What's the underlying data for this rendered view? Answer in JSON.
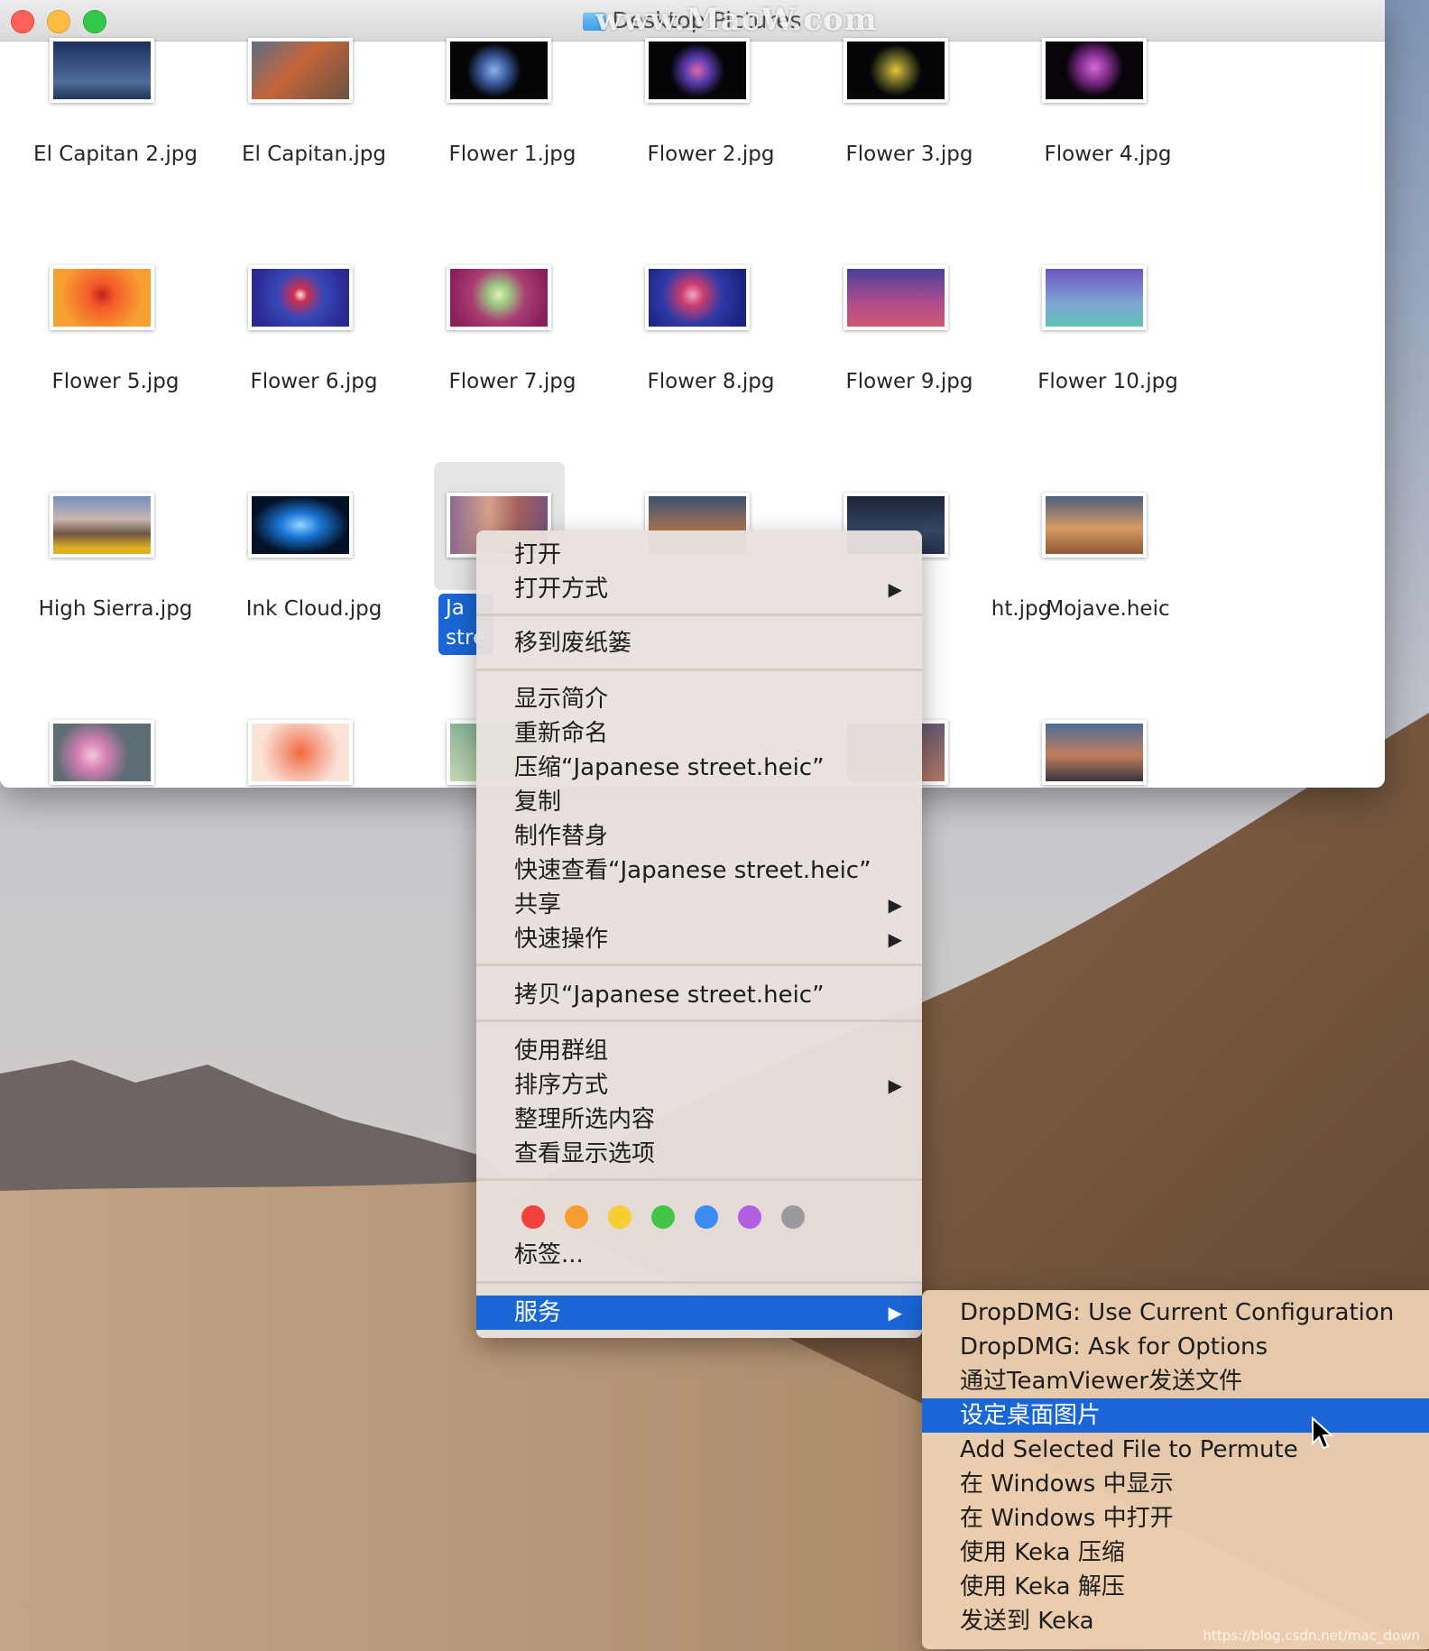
{
  "window": {
    "title": "Desktop Pictures",
    "watermark": "www.MacW.com"
  },
  "files": [
    {
      "name": "El Capitan 2.jpg"
    },
    {
      "name": "El Capitan.jpg"
    },
    {
      "name": "Flower 1.jpg"
    },
    {
      "name": "Flower 2.jpg"
    },
    {
      "name": "Flower 3.jpg"
    },
    {
      "name": "Flower 4.jpg"
    },
    {
      "name": "Flower 5.jpg"
    },
    {
      "name": "Flower 6.jpg"
    },
    {
      "name": "Flower 7.jpg"
    },
    {
      "name": "Flower 8.jpg"
    },
    {
      "name": "Flower 9.jpg"
    },
    {
      "name": "Flower 10.jpg"
    },
    {
      "name": "High Sierra.jpg"
    },
    {
      "name": "Ink Cloud.jpg"
    },
    {
      "name": "Ja stre"
    },
    {
      "name": ""
    },
    {
      "name": "ht.jpg"
    },
    {
      "name": "Mojave.heic"
    }
  ],
  "context_menu": {
    "open": "打开",
    "open_with": "打开方式",
    "move_to_trash": "移到废纸篓",
    "get_info": "显示简介",
    "rename": "重新命名",
    "compress": "压缩“Japanese street.heic”",
    "duplicate": "复制",
    "make_alias": "制作替身",
    "quick_look": "快速查看“Japanese street.heic”",
    "share": "共享",
    "quick_actions": "快速操作",
    "copy": "拷贝“Japanese street.heic”",
    "use_groups": "使用群组",
    "sort_by": "排序方式",
    "clean_up_selection": "整理所选内容",
    "show_view_options": "查看显示选项",
    "tags": "标签...",
    "services": "服务",
    "arrow": "▶"
  },
  "tag_colors": [
    "#f2413a",
    "#f89b31",
    "#f7cf33",
    "#42c447",
    "#3b8cf0",
    "#b25fe0",
    "#9a9a9c"
  ],
  "services_submenu": [
    "DropDMG: Use Current Configuration",
    "DropDMG: Ask for Options",
    "通过TeamViewer发送文件",
    "设定桌面图片",
    "Add Selected File to Permute",
    "在 Windows 中显示",
    "在 Windows 中打开",
    "使用 Keka 压缩",
    "使用 Keka 解压",
    "发送到 Keka"
  ],
  "credit": "https://blog.csdn.net/mac_down"
}
